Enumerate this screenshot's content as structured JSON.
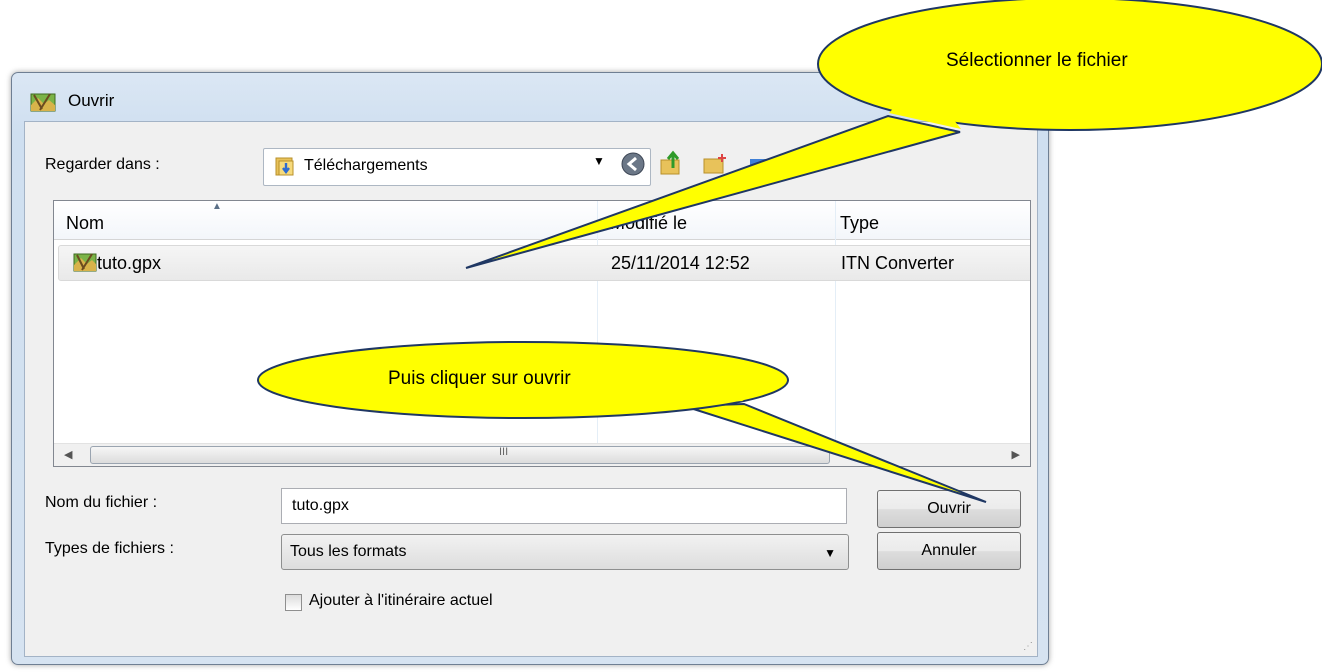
{
  "window": {
    "title": "Ouvrir"
  },
  "lookin": {
    "label": "Regarder dans :",
    "value": "Téléchargements"
  },
  "list": {
    "columns": [
      "Nom",
      "Modifié le",
      "Type"
    ],
    "rows": [
      {
        "name": "tuto.gpx",
        "modified": "25/11/2014 12:52",
        "type": "ITN Converter"
      }
    ],
    "scroll_grip": "III"
  },
  "filename": {
    "label": "Nom du fichier :",
    "value": "tuto.gpx"
  },
  "filetype": {
    "label": "Types de fichiers :",
    "value": "Tous les formats"
  },
  "buttons": {
    "open": "Ouvrir",
    "cancel": "Annuler"
  },
  "checkbox": {
    "label": "Ajouter à l'itinéraire actuel",
    "checked": false
  },
  "callouts": {
    "select_file": "Sélectionner le fichier",
    "click_open": "Puis cliquer sur ouvrir",
    "fill_color": "#ffff00",
    "stroke_color": "#1f3763"
  },
  "icons": [
    "app-icon",
    "folder-icon",
    "back-icon",
    "up-folder-icon",
    "new-folder-icon",
    "views-icon",
    "file-icon",
    "chevron-down-icon",
    "scroll-left-icon",
    "scroll-right-icon",
    "sort-up-icon",
    "resize-grip-icon"
  ]
}
